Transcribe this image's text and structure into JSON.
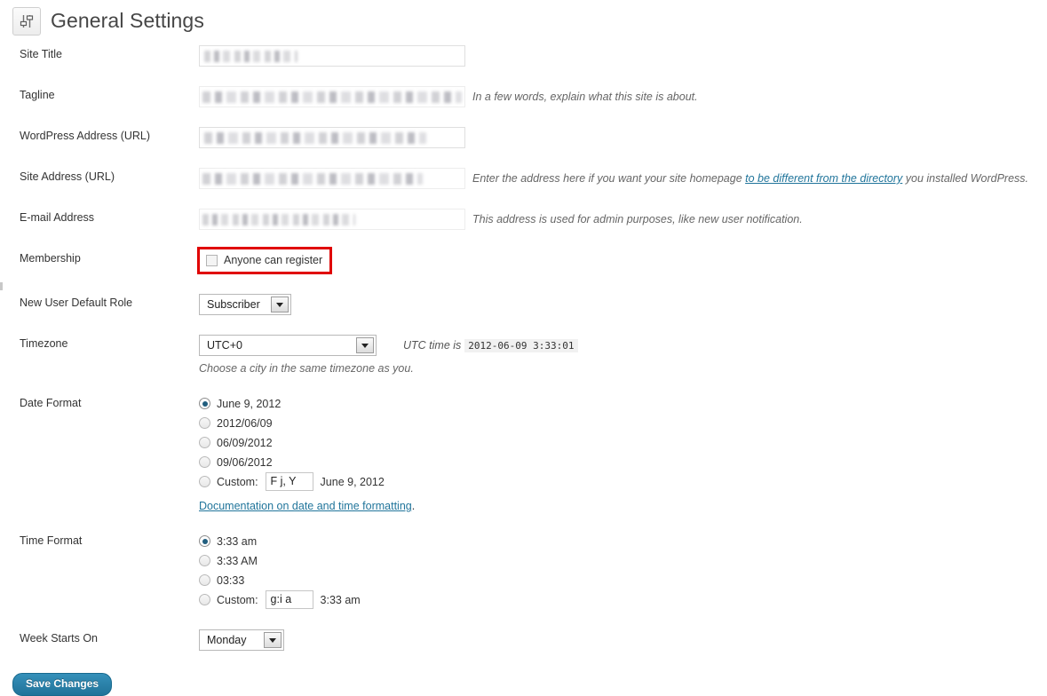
{
  "header": {
    "title": "General Settings",
    "icon": "settings-sliders-icon"
  },
  "fields": {
    "site_title": {
      "label": "Site Title",
      "value": "",
      "redacted": true,
      "redacted_width": 105
    },
    "tagline": {
      "label": "Tagline",
      "value": "",
      "redacted": true,
      "redacted_width": 292,
      "description": "In a few words, explain what this site is about."
    },
    "wordpress_address": {
      "label": "WordPress Address (URL)",
      "value": "",
      "redacted": true,
      "redacted_width": 250
    },
    "site_address": {
      "label": "Site Address (URL)",
      "value": "",
      "redacted": true,
      "redacted_width": 248,
      "description_before": "Enter the address here if you want your site homepage ",
      "description_link": "to be different from the directory",
      "description_after": " you installed WordPress."
    },
    "email_address": {
      "label": "E-mail Address",
      "value": "",
      "redacted": true,
      "redacted_width": 172,
      "description": "This address is used for admin purposes, like new user notification."
    },
    "membership": {
      "label": "Membership",
      "checkbox_label": "Anyone can register",
      "checked": false,
      "highlight_color": "#e00000"
    },
    "new_user_default_role": {
      "label": "New User Default Role",
      "selected": "Subscriber"
    },
    "timezone": {
      "label": "Timezone",
      "selected": "UTC+0",
      "utc_note_label": "UTC time is",
      "utc_time": "2012-06-09 3:33:01",
      "sub_note": "Choose a city in the same timezone as you."
    },
    "date_format": {
      "label": "Date Format",
      "options": [
        {
          "label": "June 9, 2012",
          "selected": true
        },
        {
          "label": "2012/06/09",
          "selected": false
        },
        {
          "label": "06/09/2012",
          "selected": false
        },
        {
          "label": "09/06/2012",
          "selected": false
        }
      ],
      "custom_label": "Custom:",
      "custom_value": "F j, Y",
      "custom_preview": "June 9, 2012",
      "custom_selected": false,
      "doc_link": "Documentation on date and time formatting",
      "doc_link_suffix": "."
    },
    "time_format": {
      "label": "Time Format",
      "options": [
        {
          "label": "3:33 am",
          "selected": true
        },
        {
          "label": "3:33 AM",
          "selected": false
        },
        {
          "label": "03:33",
          "selected": false
        }
      ],
      "custom_label": "Custom:",
      "custom_value": "g:i a",
      "custom_preview": "3:33 am",
      "custom_selected": false
    },
    "week_starts_on": {
      "label": "Week Starts On",
      "selected": "Monday"
    }
  },
  "submit": {
    "save_label": "Save Changes"
  }
}
